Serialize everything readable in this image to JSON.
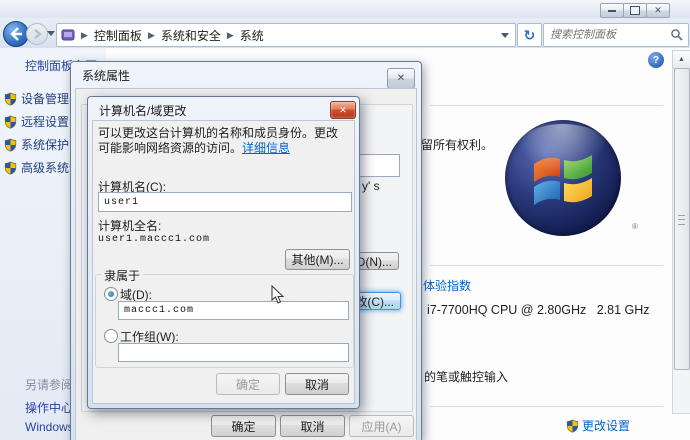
{
  "window": {
    "breadcrumb": {
      "items": [
        "控制面板",
        "系统和安全",
        "系统"
      ]
    },
    "search_placeholder": "搜索控制面板"
  },
  "sidebar": {
    "home": "控制面板主页",
    "tasks": [
      "设备管理器",
      "远程设置",
      "系统保护",
      "高级系统设置"
    ],
    "see_also_header": "另请参阅",
    "see_also_links": [
      "操作中心",
      "Windows Update"
    ]
  },
  "content": {
    "rights_text": "留所有权利。",
    "experience_link": "体验指数",
    "cpu_text": "i7-7700HQ CPU @ 2.80GHz   2.81 GHz",
    "pen_touch_text": "的笔或触控输入",
    "change_settings_link": "更改设置",
    "registered_mark": "®"
  },
  "sysprops_dialog": {
    "title": "系统属性",
    "example_fragment": "y' s",
    "network_id_button": "网络 ID(N)...",
    "change_button": "更改(C)...",
    "ok": "确定",
    "cancel": "取消",
    "apply": "应用(A)"
  },
  "rename_dialog": {
    "title": "计算机名/域更改",
    "intro": "可以更改这台计算机的名称和成员身份。更改可能影响网络资源的访问。",
    "intro_link": "详细信息",
    "computer_name_label": "计算机名(C):",
    "computer_name_value": "user1",
    "full_name_label": "计算机全名:",
    "full_name_value": "user1.maccc1.com",
    "more_button": "其他(M)...",
    "member_of_label": "隶属于",
    "domain_label": "域(D):",
    "domain_value": "maccc1.com",
    "workgroup_label": "工作组(W):",
    "workgroup_value": "",
    "ok": "确定",
    "cancel": "取消"
  },
  "colors": {
    "link_blue": "#0066cc",
    "accent_blue": "#2a6cc4",
    "close_red": "#cf4d2a"
  }
}
